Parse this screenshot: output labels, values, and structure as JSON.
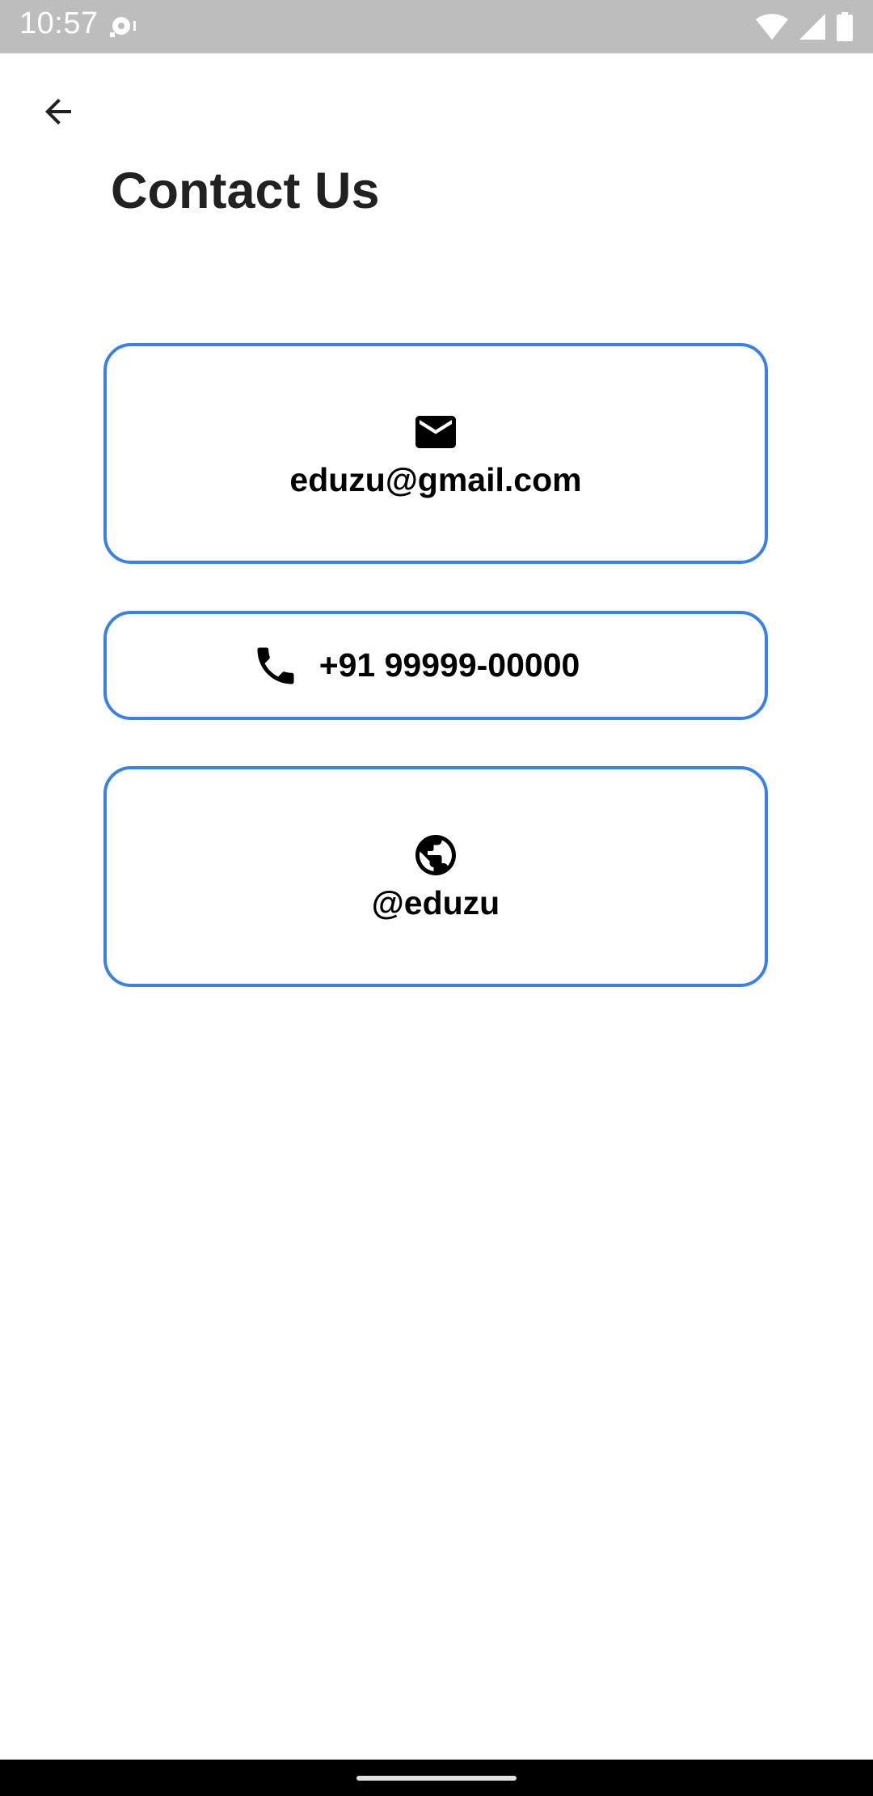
{
  "status_bar": {
    "time": "10:57",
    "icons": [
      "notification-icon",
      "wifi-icon",
      "cell-signal-icon",
      "battery-icon"
    ],
    "background_color": "#bdbdbd"
  },
  "header": {
    "back_icon": "arrow-back-icon",
    "title": "Contact Us"
  },
  "contacts": {
    "accent_color": "#3a81e6",
    "email": {
      "icon": "email-icon",
      "label": "eduzu@gmail.com"
    },
    "phone": {
      "icon": "phone-icon",
      "label": "+91 99999-00000"
    },
    "social": {
      "icon": "globe-icon",
      "label": "@eduzu"
    }
  }
}
